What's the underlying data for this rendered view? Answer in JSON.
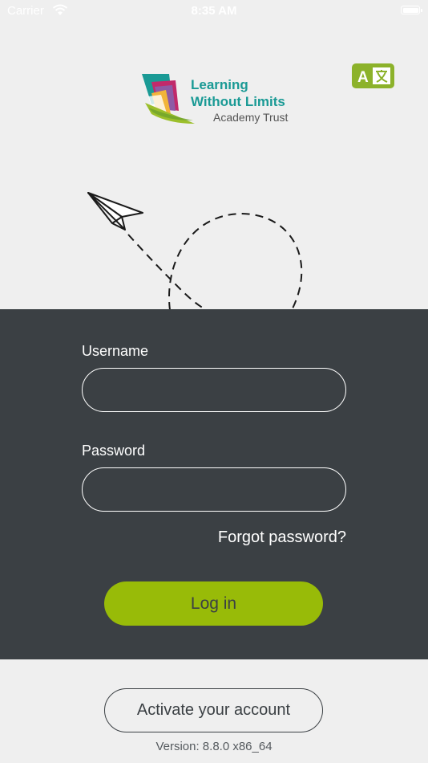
{
  "status_bar": {
    "carrier": "Carrier",
    "time": "8:35 AM"
  },
  "logo": {
    "line1": "Learning",
    "line2": "Without Limits",
    "line3": "Academy Trust"
  },
  "translate_button": {
    "icon": "translate-icon",
    "letter": "A"
  },
  "login": {
    "username_label": "Username",
    "username_value": "",
    "password_label": "Password",
    "password_value": "",
    "forgot_password": "Forgot password?",
    "login_button": "Log in"
  },
  "activate_button": "Activate your account",
  "version": "Version: 8.8.0 x86_64",
  "colors": {
    "panel": "#3b4044",
    "accent": "#98bb08",
    "logo_text": "#1a9a95",
    "background": "#efefef"
  }
}
